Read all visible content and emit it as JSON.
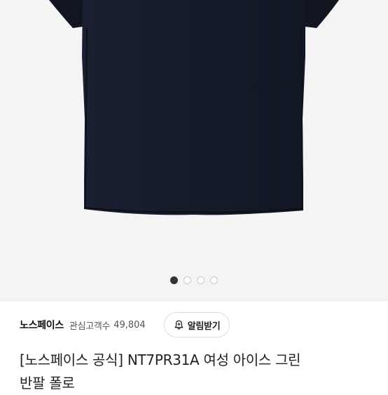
{
  "gallery": {
    "image_alt": "navy short-sleeve shirt product photo",
    "page_count": 4,
    "current_page": 1
  },
  "store": {
    "brand_name": "노스페이스",
    "favorites_label": "관심고객수",
    "favorites_count": "49,804",
    "alarm_button_label": "알림받기",
    "alarm_icon": "bell-plus-icon"
  },
  "product": {
    "title_line1": "[노스페이스 공식] NT7PR31A 여성 아이스 그린",
    "title_line2": "반팔 폴로"
  },
  "colors": {
    "garment": "#141a27",
    "background": "#f4f4f4",
    "indicator_active": "#333333"
  }
}
